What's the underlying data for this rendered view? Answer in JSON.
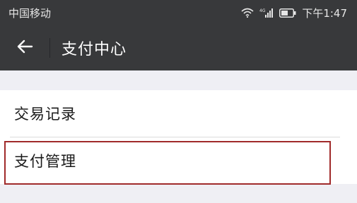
{
  "status_bar": {
    "carrier": "中国移动",
    "network_label": "4G",
    "time": "下午1:47",
    "icons": [
      "wifi-icon",
      "signal-icon",
      "battery-icon"
    ]
  },
  "header": {
    "title": "支付中心",
    "back_icon": "arrow-left-icon"
  },
  "menu": {
    "items": [
      {
        "label": "交易记录"
      },
      {
        "label": "支付管理"
      }
    ]
  },
  "colors": {
    "header_bg": "#38393b",
    "page_bg": "#efeff4",
    "highlight_border": "#a02a2a"
  }
}
